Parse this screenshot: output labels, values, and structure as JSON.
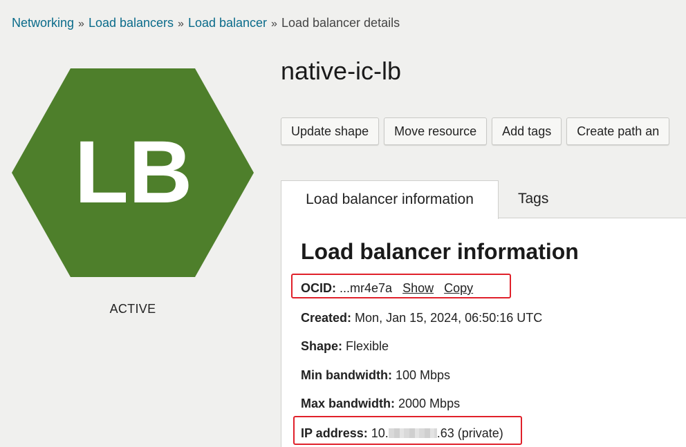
{
  "breadcrumb": {
    "items": [
      "Networking",
      "Load balancers",
      "Load balancer"
    ],
    "separator": "»",
    "current": "Load balancer details"
  },
  "resource": {
    "icon_text": "LB",
    "icon_color": "#4e7f2b",
    "status": "ACTIVE",
    "title": "native-ic-lb"
  },
  "actions": {
    "update_shape": "Update shape",
    "move_resource": "Move resource",
    "add_tags": "Add tags",
    "create_path": "Create path an"
  },
  "tabs": {
    "info": "Load balancer information",
    "tags": "Tags"
  },
  "info": {
    "heading": "Load balancer information",
    "ocid_label": "OCID:",
    "ocid_value": "...mr4e7a",
    "show_link": "Show",
    "copy_link": "Copy",
    "created_label": "Created:",
    "created_value": "Mon, Jan 15, 2024, 06:50:16 UTC",
    "shape_label": "Shape:",
    "shape_value": "Flexible",
    "min_bw_label": "Min bandwidth:",
    "min_bw_value": "100 Mbps",
    "max_bw_label": "Max bandwidth:",
    "max_bw_value": "2000 Mbps",
    "ip_label": "IP address:",
    "ip_prefix": "10.",
    "ip_suffix": ".63 (private)"
  },
  "colors": {
    "link": "#0a6b8a",
    "highlight": "#e0202a"
  }
}
